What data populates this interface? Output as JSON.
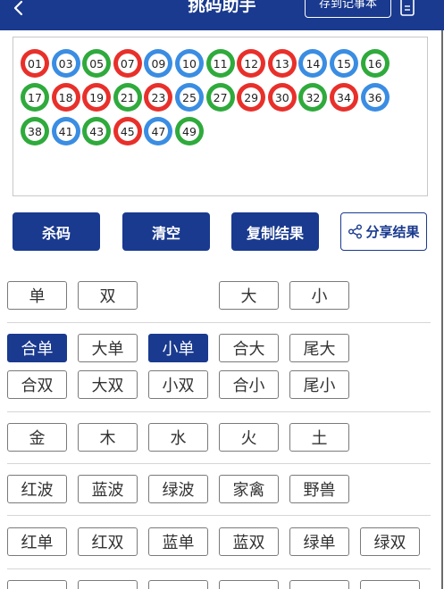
{
  "header": {
    "title": "挑码助手",
    "save_label": "存到记事本",
    "bg_color": "#1a3a8f"
  },
  "balls": [
    {
      "num": "01",
      "color": "red"
    },
    {
      "num": "03",
      "color": "blue"
    },
    {
      "num": "05",
      "color": "green"
    },
    {
      "num": "07",
      "color": "red"
    },
    {
      "num": "09",
      "color": "blue"
    },
    {
      "num": "10",
      "color": "blue"
    },
    {
      "num": "11",
      "color": "green"
    },
    {
      "num": "12",
      "color": "red"
    },
    {
      "num": "13",
      "color": "red"
    },
    {
      "num": "14",
      "color": "blue"
    },
    {
      "num": "15",
      "color": "blue"
    },
    {
      "num": "16",
      "color": "green"
    },
    {
      "num": "17",
      "color": "green"
    },
    {
      "num": "18",
      "color": "red"
    },
    {
      "num": "19",
      "color": "red"
    },
    {
      "num": "21",
      "color": "green"
    },
    {
      "num": "23",
      "color": "red"
    },
    {
      "num": "25",
      "color": "blue"
    },
    {
      "num": "27",
      "color": "green"
    },
    {
      "num": "29",
      "color": "red"
    },
    {
      "num": "30",
      "color": "red"
    },
    {
      "num": "32",
      "color": "green"
    },
    {
      "num": "34",
      "color": "red"
    },
    {
      "num": "36",
      "color": "blue"
    },
    {
      "num": "38",
      "color": "green"
    },
    {
      "num": "41",
      "color": "blue"
    },
    {
      "num": "43",
      "color": "green"
    },
    {
      "num": "45",
      "color": "red"
    },
    {
      "num": "47",
      "color": "blue"
    },
    {
      "num": "49",
      "color": "green"
    }
  ],
  "actions": {
    "kill": "杀码",
    "clear": "清空",
    "copy": "复制结果",
    "share": "分享结果"
  },
  "filters": {
    "odd": "单",
    "even": "双",
    "big": "大",
    "small": "小",
    "sum_odd": "合单",
    "big_odd": "大单",
    "small_odd": "小单",
    "sum_big": "合大",
    "tail_big": "尾大",
    "sum_even": "合双",
    "big_even": "大双",
    "small_even": "小双",
    "sum_small": "合小",
    "tail_small": "尾小",
    "metal": "金",
    "wood": "木",
    "water": "水",
    "fire": "火",
    "earth": "土",
    "red_wave": "红波",
    "blue_wave": "蓝波",
    "green_wave": "绿波",
    "poultry": "家禽",
    "beast": "野兽",
    "red_odd": "红单",
    "red_even": "红双",
    "blue_odd": "蓝单",
    "blue_even": "蓝双",
    "green_odd": "绿单",
    "green_even": "绿双"
  },
  "active_filters": [
    "sum_odd",
    "small_odd"
  ]
}
